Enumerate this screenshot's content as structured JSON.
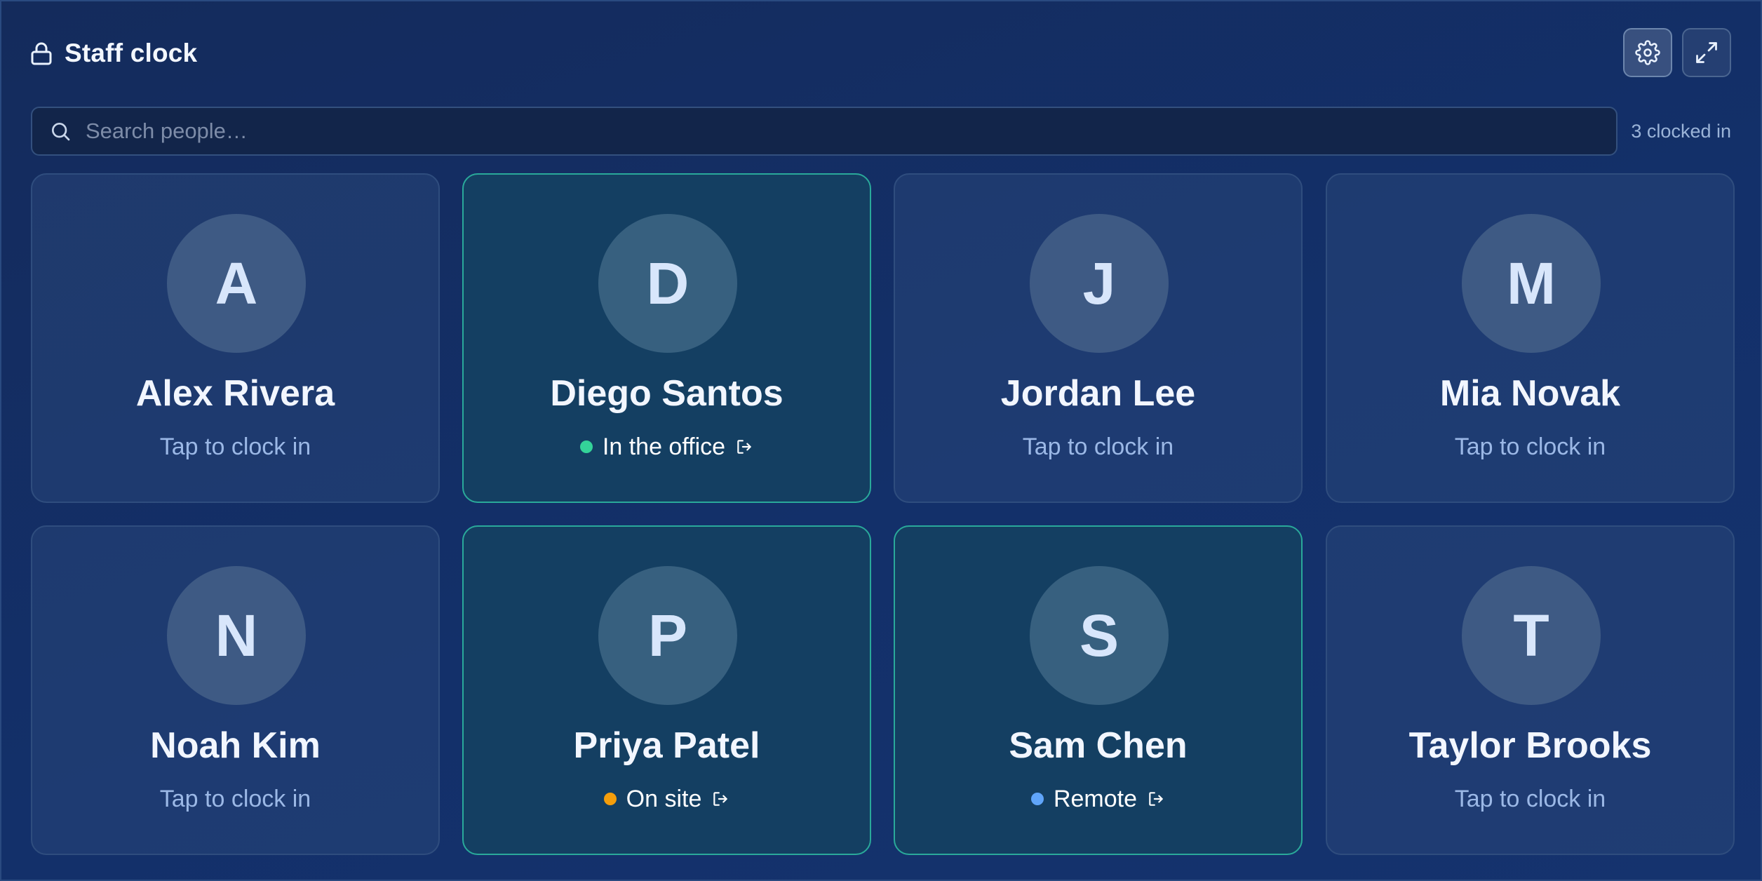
{
  "header": {
    "title": "Staff clock",
    "lock_icon": "lock-icon",
    "settings_icon": "gear-icon",
    "fullscreen_icon": "expand-icon"
  },
  "search": {
    "placeholder": "Search people…",
    "value": "",
    "icon": "search-icon"
  },
  "summary": {
    "clocked_in_text": "3 clocked in"
  },
  "colors": {
    "active_border": "#2aa99a",
    "office_dot": "#34d399",
    "onsite_dot": "#f59e0b",
    "remote_dot": "#60a5fa"
  },
  "people": [
    {
      "initial": "A",
      "name": "Alex Rivera",
      "status": "Tap to clock in",
      "clocked_in": false
    },
    {
      "initial": "D",
      "name": "Diego Santos",
      "status": "In the office",
      "clocked_in": true,
      "dot_color": "#34d399"
    },
    {
      "initial": "J",
      "name": "Jordan Lee",
      "status": "Tap to clock in",
      "clocked_in": false
    },
    {
      "initial": "M",
      "name": "Mia Novak",
      "status": "Tap to clock in",
      "clocked_in": false
    },
    {
      "initial": "N",
      "name": "Noah Kim",
      "status": "Tap to clock in",
      "clocked_in": false
    },
    {
      "initial": "P",
      "name": "Priya Patel",
      "status": "On site",
      "clocked_in": true,
      "dot_color": "#f59e0b"
    },
    {
      "initial": "S",
      "name": "Sam Chen",
      "status": "Remote",
      "clocked_in": true,
      "dot_color": "#60a5fa"
    },
    {
      "initial": "T",
      "name": "Taylor Brooks",
      "status": "Tap to clock in",
      "clocked_in": false
    }
  ]
}
